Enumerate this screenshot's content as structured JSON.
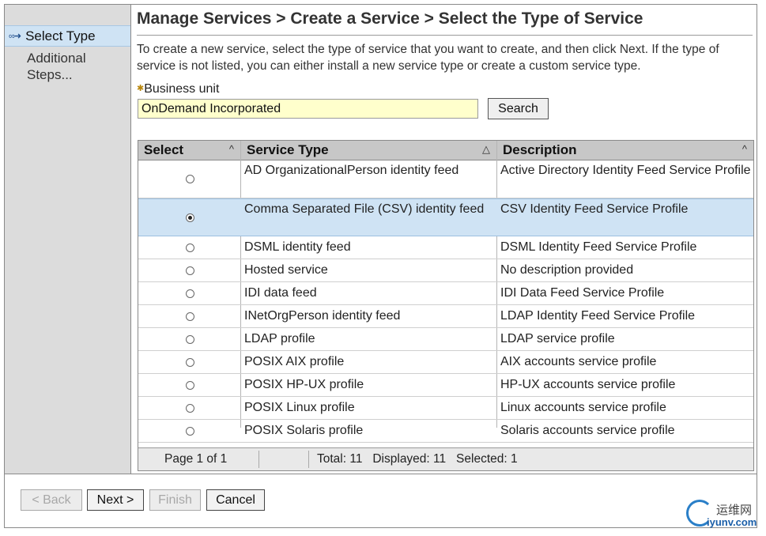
{
  "sidebar": {
    "active_step": "Select Type",
    "next_step": "Additional Steps..."
  },
  "page": {
    "title": "Manage Services > Create a Service > Select the Type of Service",
    "intro": "To create a new service, select the type of service that you want to create, and then click Next. If the type of service is not listed, you can either install a new service type or create a custom service type."
  },
  "business_unit": {
    "required_marker": "✱",
    "label": "Business unit",
    "value": "OnDemand Incorporated",
    "search_label": "Search"
  },
  "table": {
    "columns": [
      "Select",
      "Service Type",
      "Description"
    ],
    "rows": [
      {
        "selected": false,
        "type": "AD OrganizationalPerson identity feed",
        "description": "Active Directory Identity Feed Service Profile"
      },
      {
        "selected": true,
        "type": "Comma Separated File (CSV) identity feed",
        "description": "CSV Identity Feed Service Profile"
      },
      {
        "selected": false,
        "type": "DSML identity feed",
        "description": "DSML Identity Feed Service Profile"
      },
      {
        "selected": false,
        "type": "Hosted service",
        "description": "No description provided"
      },
      {
        "selected": false,
        "type": "IDI data feed",
        "description": "IDI Data Feed Service Profile"
      },
      {
        "selected": false,
        "type": "INetOrgPerson identity feed",
        "description": "LDAP Identity Feed Service Profile"
      },
      {
        "selected": false,
        "type": "LDAP profile",
        "description": "LDAP service profile"
      },
      {
        "selected": false,
        "type": "POSIX AIX profile",
        "description": "AIX accounts service profile"
      },
      {
        "selected": false,
        "type": "POSIX HP-UX profile",
        "description": "HP-UX accounts service profile"
      },
      {
        "selected": false,
        "type": "POSIX Linux profile",
        "description": "Linux accounts service profile"
      },
      {
        "selected": false,
        "type": "POSIX Solaris profile",
        "description": "Solaris accounts service profile"
      }
    ],
    "footer": {
      "page": "Page 1 of 1",
      "summary": "Total: 11   Displayed: 11   Selected: 1"
    }
  },
  "wizard_buttons": {
    "back": "< Back",
    "next": "Next >",
    "finish": "Finish",
    "cancel": "Cancel"
  },
  "watermark": {
    "cn": "运维网",
    "url": "iyunv.com"
  },
  "colors": {
    "selection": "#cfe3f4",
    "sidebar": "#dcdcdc",
    "header": "#c7c7c7",
    "input_bg": "#ffffcc"
  }
}
